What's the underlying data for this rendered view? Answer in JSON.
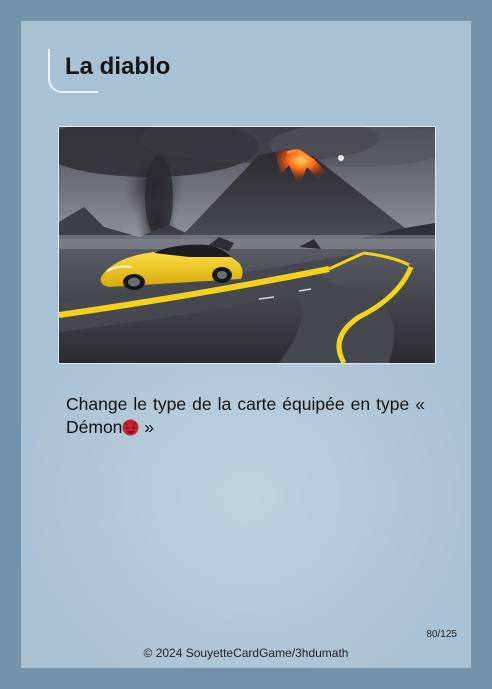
{
  "card": {
    "title": "La diablo",
    "description_part1": "Change le type de la carte équipée en type « Démon",
    "description_part2": " »",
    "type_icon": "demon-icon",
    "card_number": "80/125",
    "copyright": "© 2024 SouyetteCardGame/3hdumath",
    "illustration": "yellow-sports-car-on-road-before-erupting-volcano",
    "colors": {
      "frame": "#7493ab",
      "card_face": "#a9c1d4",
      "text": "#111111",
      "demon_icon": "#c4232d"
    }
  }
}
